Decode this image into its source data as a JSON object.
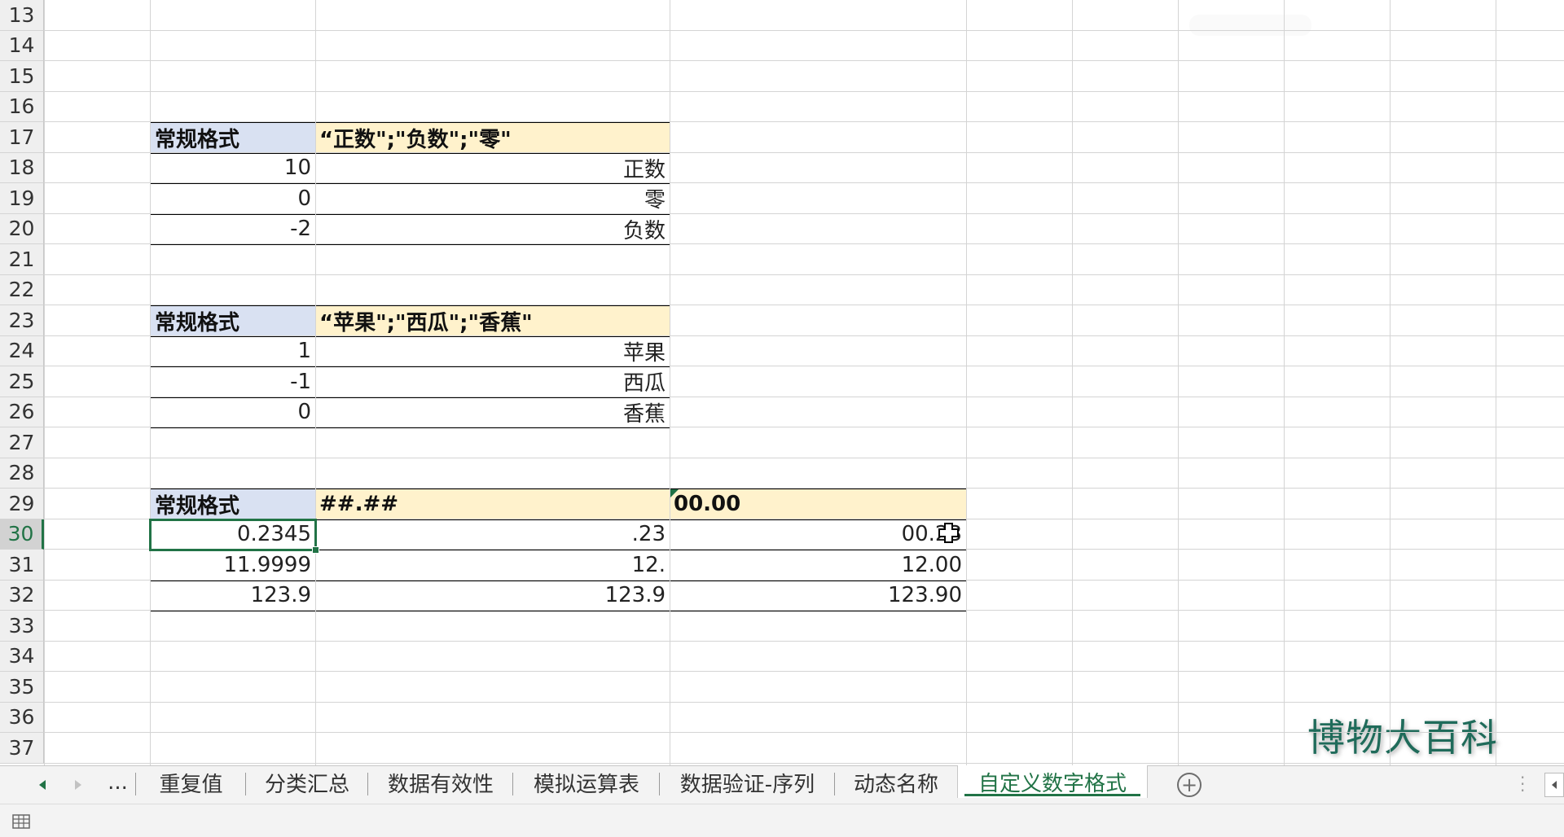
{
  "rows": [
    "13",
    "14",
    "15",
    "16",
    "17",
    "18",
    "19",
    "20",
    "21",
    "22",
    "23",
    "24",
    "25",
    "26",
    "27",
    "28",
    "29",
    "30",
    "31",
    "32",
    "33",
    "34",
    "35",
    "36",
    "37"
  ],
  "active_row": "30",
  "table1": {
    "header": [
      "常规格式",
      "“正数\";\"负数\";\"零\""
    ],
    "rows": [
      [
        "10",
        "正数"
      ],
      [
        "0",
        "零"
      ],
      [
        "-2",
        "负数"
      ]
    ]
  },
  "table2": {
    "header": [
      "常规格式",
      "“苹果\";\"西瓜\";\"香蕉\""
    ],
    "rows": [
      [
        "1",
        "苹果"
      ],
      [
        "-1",
        "西瓜"
      ],
      [
        "0",
        "香蕉"
      ]
    ]
  },
  "table3": {
    "header": [
      "常规格式",
      "##.##",
      "00.00"
    ],
    "rows": [
      [
        "0.2345",
        ".23",
        "00.23"
      ],
      [
        "11.9999",
        "12.",
        "12.00"
      ],
      [
        "123.9",
        "123.9",
        "123.90"
      ]
    ]
  },
  "watermark": "博物大百科",
  "tabbar": {
    "prev_icon": "triangle-left-icon",
    "next_icon": "triangle-right-icon",
    "ellipsis": "...",
    "tabs": [
      "重复值",
      "分类汇总",
      "数据有效性",
      "模拟运算表",
      "数据验证-序列",
      "动态名称",
      "自定义数字格式"
    ],
    "active_tab": "自定义数字格式",
    "add_label": "+"
  },
  "colors": {
    "accent": "#217346",
    "header_blue": "#d9e1f2",
    "header_peach": "#fff2cc"
  }
}
